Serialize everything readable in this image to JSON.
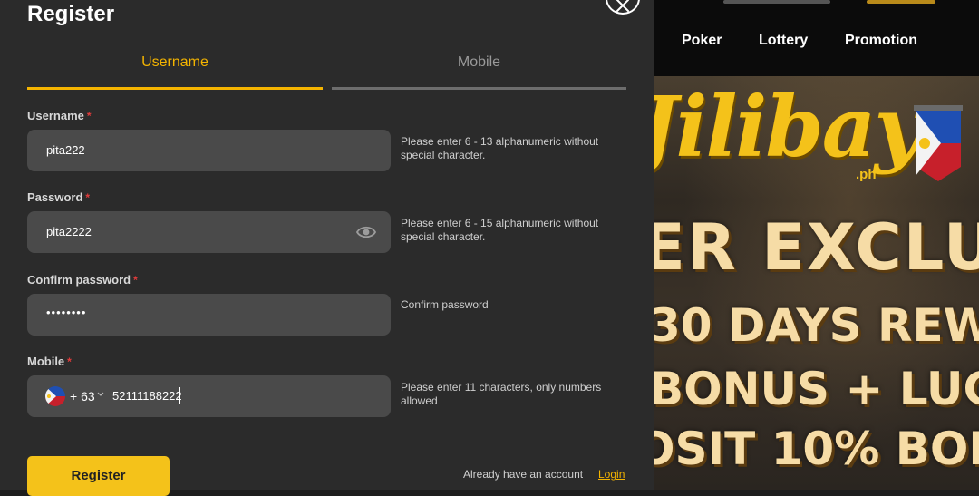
{
  "modal": {
    "title": "Register",
    "tabs": [
      {
        "label": "Username",
        "active": true
      },
      {
        "label": "Mobile",
        "active": false
      }
    ],
    "fields": {
      "username": {
        "label": "Username",
        "required": "*",
        "value": "pita222",
        "hint": "Please enter 6 - 13 alphanumeric without special character."
      },
      "password": {
        "label": "Password",
        "required": "*",
        "value": "pita2222",
        "hint": "Please enter 6 - 15 alphanumeric without special character."
      },
      "confirm": {
        "label": "Confirm password",
        "required": "*",
        "value": "••••••••",
        "hint": "Confirm password"
      },
      "mobile": {
        "label": "Mobile",
        "required": "*",
        "dial_code": "+ 63",
        "value": "52111188222",
        "hint": "Please enter 11 characters, only numbers allowed"
      }
    },
    "register_label": "Register",
    "already_text": "Already have an account",
    "login_label": "Login"
  },
  "site": {
    "nav": [
      "Poker",
      "Lottery",
      "Promotion"
    ],
    "logo": "Jilibay",
    "logo_suffix": ".ph",
    "promo_lines": [
      "ER EXCLU",
      "30 DAYS REW",
      "BONUS + LUC",
      "OSIT 10% BON"
    ]
  },
  "colors": {
    "accent": "#f4b400",
    "button": "#f4c21a",
    "modal_bg": "#2b2b2b",
    "field_bg": "#4a4a4a",
    "required": "#e03b3b"
  },
  "icons": [
    "close-icon",
    "eye-icon",
    "ph-flag-icon",
    "chevron-down-icon"
  ]
}
